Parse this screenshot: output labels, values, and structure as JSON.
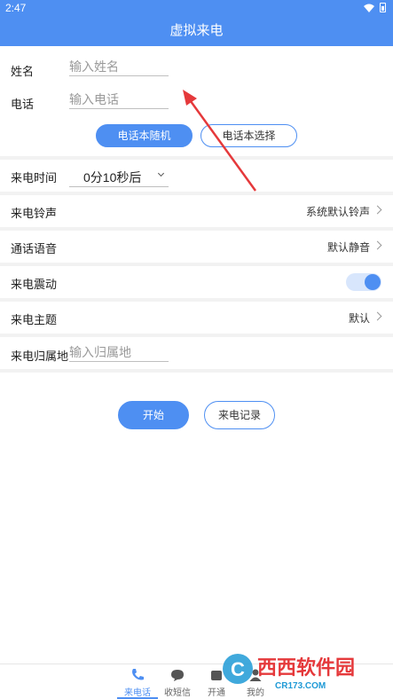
{
  "status_bar": {
    "time": "2:47",
    "icons": [
      "wifi-icon",
      "battery-icon"
    ]
  },
  "app_bar": {
    "title": "虚拟来电"
  },
  "form": {
    "name": {
      "label": "姓名",
      "placeholder": "输入姓名",
      "value": ""
    },
    "phone": {
      "label": "电话",
      "placeholder": "输入电话",
      "value": ""
    },
    "random_button": "电话本随机",
    "select_button": "电话本选择"
  },
  "settings": {
    "call_time": {
      "label": "来电时间",
      "value": "0分10秒后"
    },
    "ringtone": {
      "label": "来电铃声",
      "value": "系统默认铃声"
    },
    "voice": {
      "label": "通话语音",
      "value": "默认静音"
    },
    "vibrate": {
      "label": "来电震动",
      "on": true
    },
    "theme": {
      "label": "来电主题",
      "value": "默认"
    },
    "location": {
      "label": "来电归属地",
      "placeholder": "输入归属地",
      "value": ""
    }
  },
  "actions": {
    "start": "开始",
    "history": "来电记录"
  },
  "bottom_nav": [
    {
      "label": "来电话",
      "icon": "phone-icon",
      "active": true
    },
    {
      "label": "收短信",
      "icon": "message-icon",
      "active": false
    },
    {
      "label": "开通",
      "icon": "open-icon",
      "active": false
    },
    {
      "label": "我的",
      "icon": "profile-icon",
      "active": false
    }
  ],
  "watermark": {
    "brand": "西西软件园",
    "domain": "CR173.COM"
  },
  "colors": {
    "accent": "#4e8ff2",
    "annotation": "#e5393b"
  }
}
